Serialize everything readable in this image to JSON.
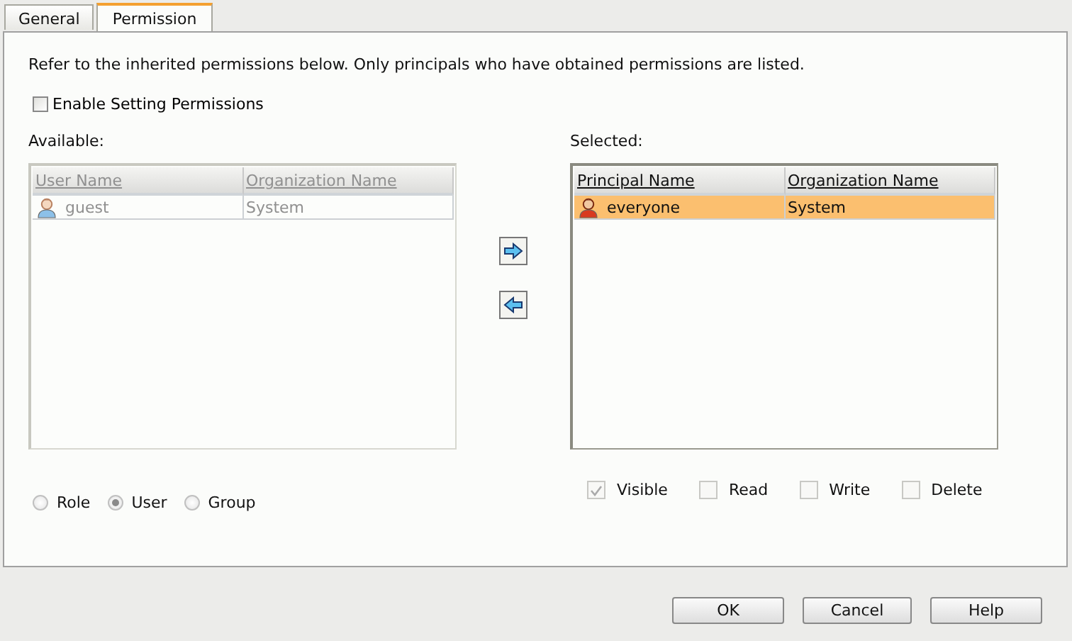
{
  "tabs": [
    {
      "label": "General",
      "selected": false
    },
    {
      "label": "Permission",
      "selected": true
    }
  ],
  "description": "Refer to the inherited permissions below. Only principals who have obtained permissions are listed.",
  "enable_setting": {
    "label": "Enable Setting Permissions",
    "checked": false
  },
  "available": {
    "label": "Available:",
    "disabled": true,
    "columns": [
      "User Name",
      "Organization Name"
    ],
    "rows": [
      {
        "name": "guest",
        "organization": "System",
        "selected": false
      }
    ]
  },
  "selected": {
    "label": "Selected:",
    "disabled": false,
    "columns": [
      "Principal Name",
      "Organization Name"
    ],
    "rows": [
      {
        "name": "everyone",
        "organization": "System",
        "selected": true
      }
    ]
  },
  "principal_type": [
    {
      "label": "Role",
      "selected": false
    },
    {
      "label": "User",
      "selected": true
    },
    {
      "label": "Group",
      "selected": false
    }
  ],
  "permissions": [
    {
      "label": "Visible",
      "checked": true
    },
    {
      "label": "Read",
      "checked": false
    },
    {
      "label": "Write",
      "checked": false
    },
    {
      "label": "Delete",
      "checked": false
    }
  ],
  "buttons": [
    "OK",
    "Cancel",
    "Help"
  ]
}
